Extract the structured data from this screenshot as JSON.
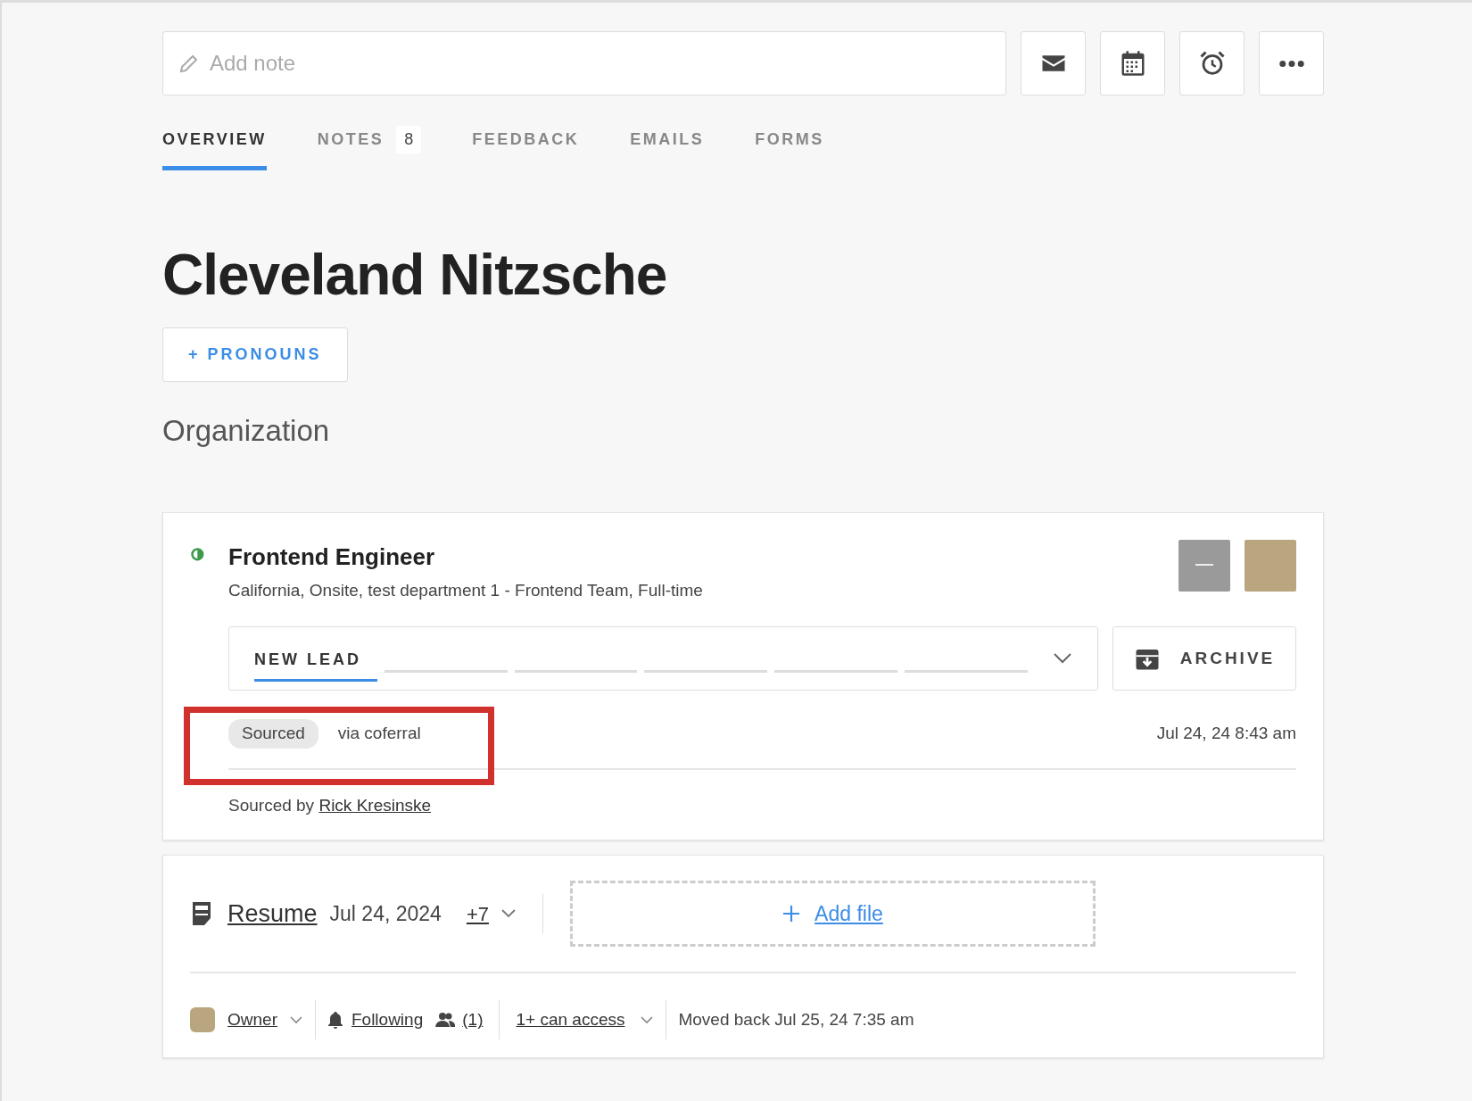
{
  "note": {
    "placeholder": "Add note"
  },
  "actions": [
    {
      "kind": "mail"
    },
    {
      "kind": "calendar"
    },
    {
      "kind": "alarm"
    },
    {
      "kind": "more"
    }
  ],
  "tabs": [
    {
      "label": "OVERVIEW",
      "selected": true
    },
    {
      "label": "NOTES",
      "count": "8",
      "selected": false
    },
    {
      "label": "FEEDBACK",
      "selected": false
    },
    {
      "label": "EMAILS",
      "selected": false
    },
    {
      "label": "FORMS",
      "selected": false
    }
  ],
  "candidate": {
    "name": "Cleveland Nitzsche",
    "pronouns_button": "+ PRONOUNS",
    "organization": "Organization"
  },
  "application": {
    "job_title": "Frontend Engineer",
    "details": "California, Onsite, test department 1 - Frontend Team, Full-time",
    "stages": [
      {
        "label": "NEW LEAD",
        "selected": true
      },
      {
        "selected": false
      },
      {
        "selected": false
      },
      {
        "selected": false
      },
      {
        "selected": false
      },
      {
        "selected": false
      }
    ],
    "archive_button": "ARCHIVE",
    "source_tag": "Sourced",
    "source_detail": "via coferral",
    "highlighted": true,
    "date": "Jul 24, 24 8:43 am",
    "sourced_by_label": "Sourced by",
    "sourced_by": "Rick Kresinske"
  },
  "files": {
    "name": "Resume",
    "date": "Jul 24, 2024",
    "more": "+7",
    "add_file": "Add file"
  },
  "footer": {
    "owner": "Owner",
    "following": "Following",
    "followers": "(1)",
    "access": "1+ can access",
    "moved": "Moved back Jul 25, 24 7:35 am"
  }
}
